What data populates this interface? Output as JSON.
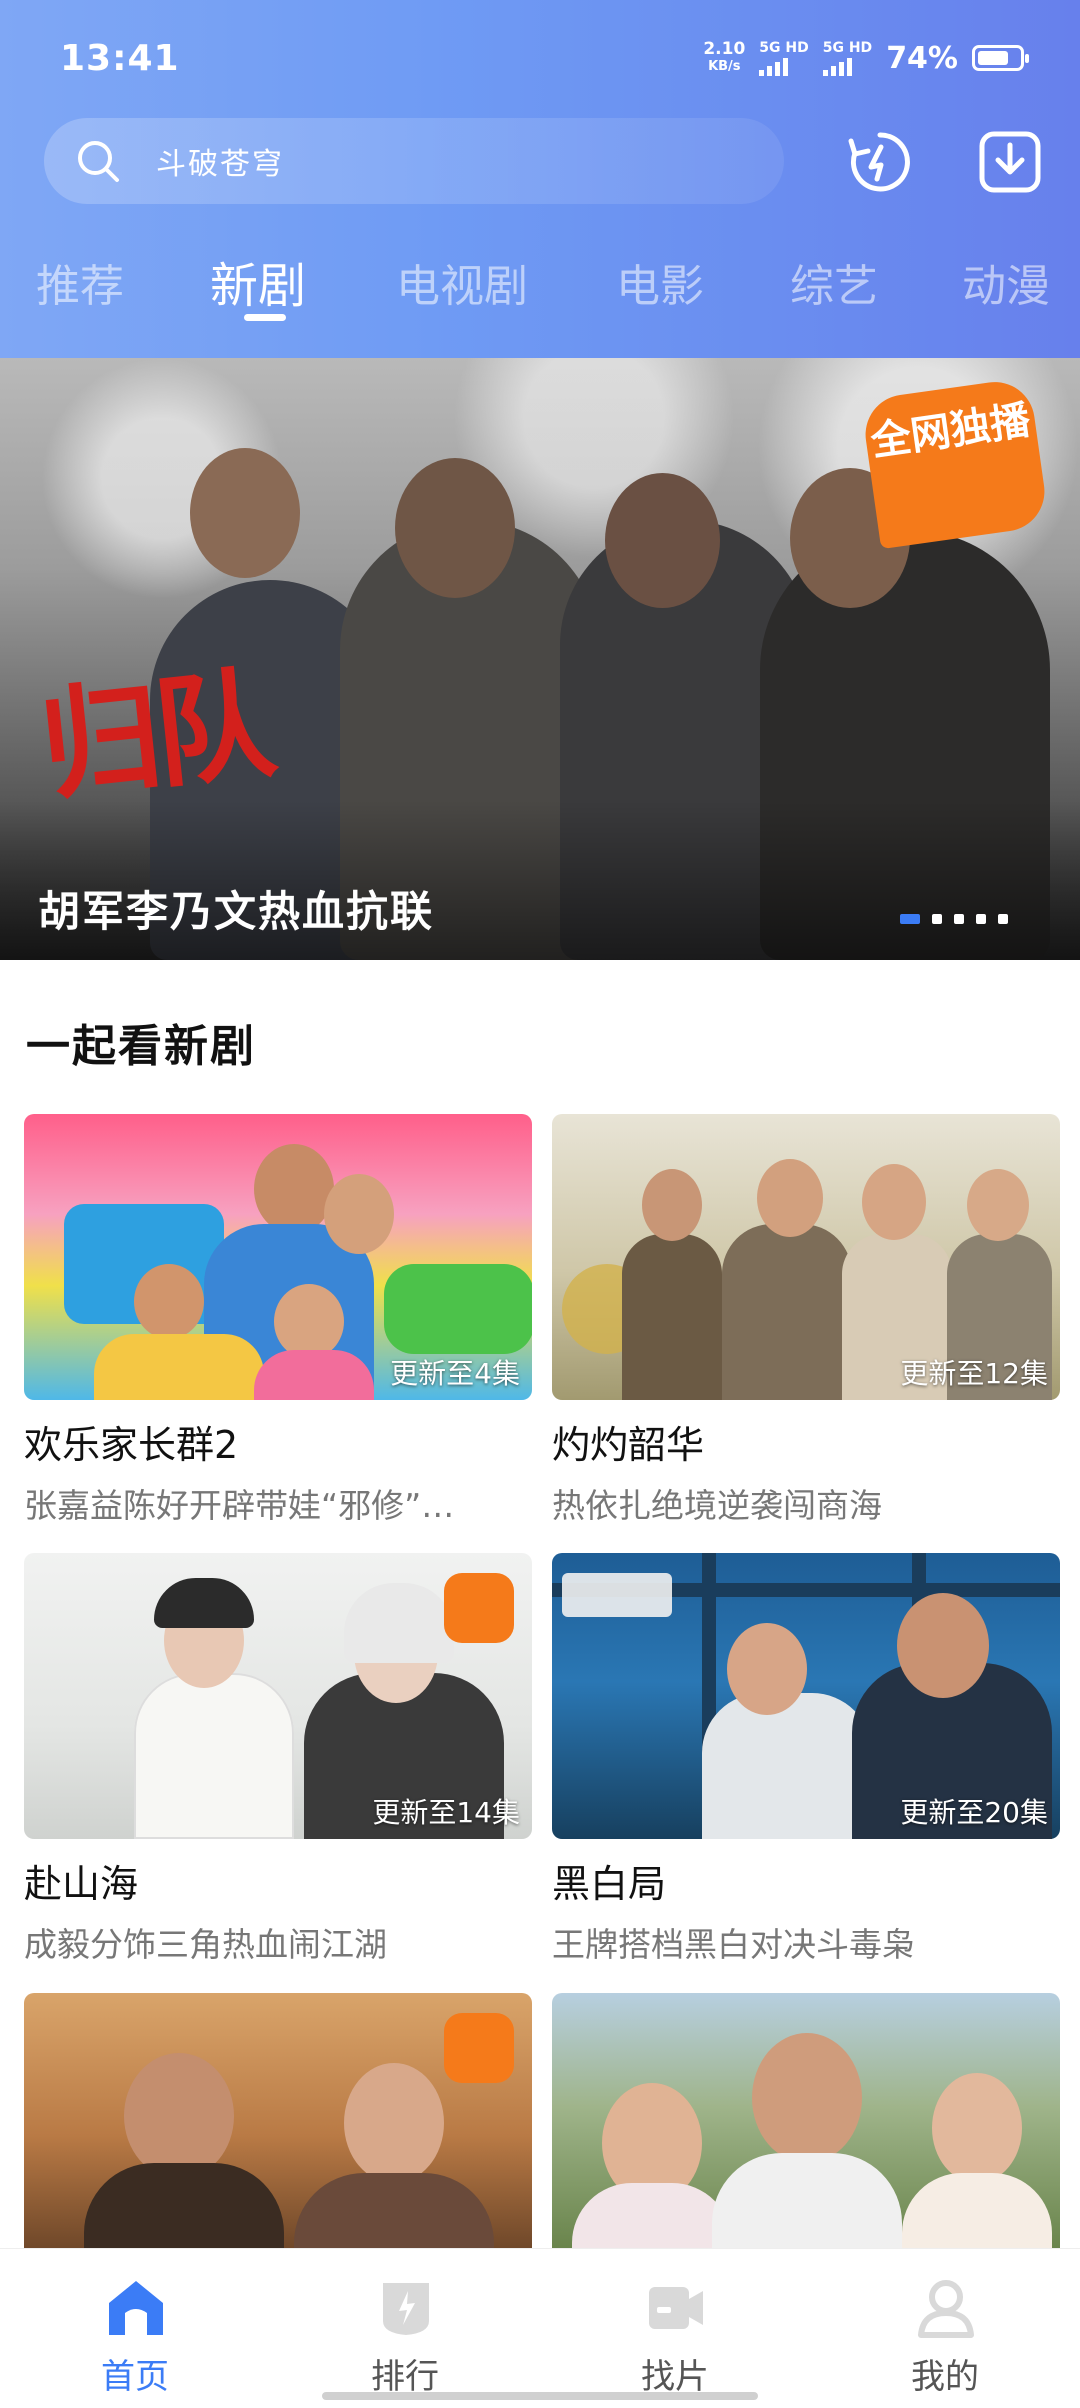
{
  "status_bar": {
    "time": "13:41",
    "net_speed": "2.10",
    "net_speed_unit": "KB/s",
    "sim1": "5G HD",
    "sim2": "5G HD",
    "battery_percent": "74%",
    "battery_level": 0.74
  },
  "header": {
    "search_placeholder": "斗破苍穹",
    "icons": [
      "search-icon",
      "history-icon",
      "download-icon"
    ],
    "tabs": [
      "推荐",
      "新剧",
      "电视剧",
      "电影",
      "综艺",
      "动漫"
    ],
    "active_tab": "新剧"
  },
  "banner": {
    "caption": "胡军李乃文热血抗联",
    "title_art": "归队",
    "badge": "全网独播",
    "page_count": 5,
    "active_page": 1
  },
  "section": {
    "title": "一起看新剧",
    "cards": [
      {
        "title": "欢乐家长群2",
        "desc": "张嘉益陈好开辟带娃“邪修”…",
        "episode": "更新至4集"
      },
      {
        "title": "灼灼韶华",
        "desc": "热依扎绝境逆袭闯商海",
        "episode": "更新至12集"
      },
      {
        "title": "赴山海",
        "desc": "成毅分饰三角热血闹江湖",
        "episode": "更新至14集"
      },
      {
        "title": "黑白局",
        "desc": "王牌搭档黑白对决斗毒枭",
        "episode": "更新至20集"
      }
    ]
  },
  "bottom_nav": {
    "items": [
      {
        "label": "首页",
        "icon": "home-icon",
        "active": true
      },
      {
        "label": "排行",
        "icon": "ranking-icon",
        "active": false
      },
      {
        "label": "找片",
        "icon": "video-icon",
        "active": false
      },
      {
        "label": "我的",
        "icon": "profile-icon",
        "active": false
      }
    ],
    "active_color": "#3b7cf6"
  },
  "colors": {
    "header_gradient_start": "#7fa7f5",
    "header_gradient_end": "#6780ec",
    "accent": "#3b7cf6"
  }
}
